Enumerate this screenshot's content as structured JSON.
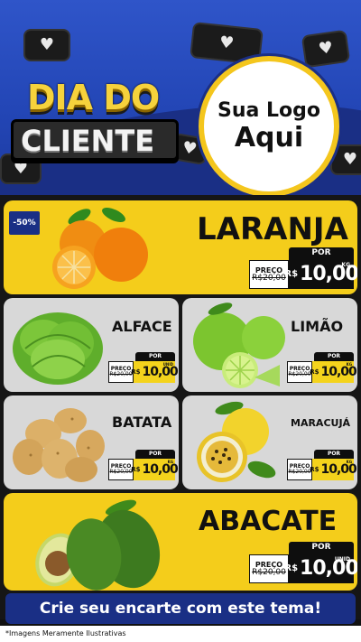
{
  "header": {
    "brand_line1": "DIA DO",
    "brand_line2": "CLIENTE",
    "logo_line1": "Sua Logo",
    "logo_line2": "Aqui"
  },
  "products": [
    {
      "name": "LARANJA",
      "discount": "-50%",
      "por": "POR",
      "preco_label": "PREÇO",
      "old_price": "R$20,00",
      "currency": "R$",
      "price": "10,00",
      "unit": "KG",
      "icon": "orange-icon"
    },
    {
      "name": "ALFACE",
      "por": "POR",
      "preco_label": "PREÇO",
      "old_price": "R$20,00",
      "currency": "R$",
      "price": "10,00",
      "unit": "UNID",
      "icon": "lettuce-icon"
    },
    {
      "name": "LIMÃO",
      "por": "POR",
      "preco_label": "PREÇO",
      "old_price": "R$20,00",
      "currency": "R$",
      "price": "10,00",
      "unit": "KG",
      "icon": "lime-icon"
    },
    {
      "name": "BATATA",
      "por": "POR",
      "preco_label": "PREÇO",
      "old_price": "R$20,00",
      "currency": "R$",
      "price": "10,00",
      "unit": "KG",
      "icon": "potato-icon"
    },
    {
      "name": "MARACUJÁ",
      "por": "POR",
      "preco_label": "PREÇO",
      "old_price": "R$20,00",
      "currency": "R$",
      "price": "10,00",
      "unit": "KG",
      "icon": "passion-fruit-icon"
    },
    {
      "name": "ABACATE",
      "por": "POR",
      "preco_label": "PREÇO",
      "old_price": "R$20,00",
      "currency": "R$",
      "price": "10,00",
      "unit": "UNID",
      "icon": "avocado-icon"
    }
  ],
  "cta": {
    "label": "Crie seu encarte com este tema!"
  },
  "footer": {
    "disclaimer": "*Imagens Meramente Ilustrativas"
  },
  "colors": {
    "blue": "#2346b6",
    "dark_blue": "#1a2f85",
    "yellow": "#f4cd1b",
    "gray_card": "#d8d8d8",
    "black": "#0e0e0e"
  }
}
